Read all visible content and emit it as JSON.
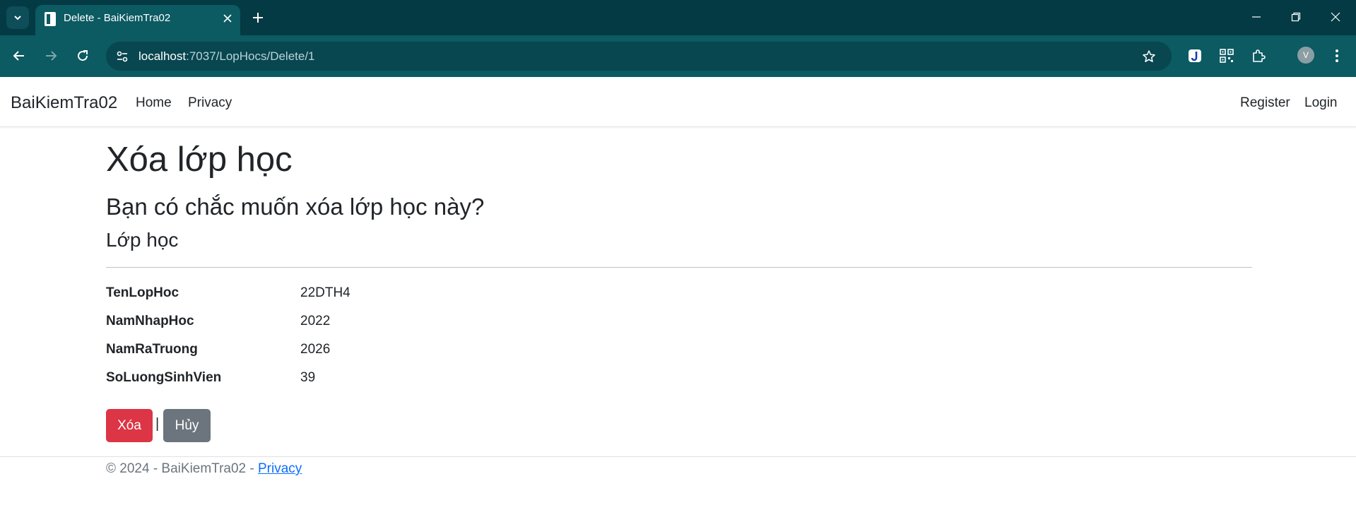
{
  "browser": {
    "tab_title": "Delete - BaiKiemTra02",
    "url_host": "localhost",
    "url_rest": ":7037/LopHocs/Delete/1",
    "profile_initial": "V"
  },
  "navbar": {
    "brand": "BaiKiemTra02",
    "links": [
      "Home",
      "Privacy"
    ],
    "register": "Register",
    "login": "Login"
  },
  "page": {
    "title": "Xóa lớp học",
    "confirm": "Bạn có chắc muốn xóa lớp học này?",
    "section": "Lớp học",
    "fields": [
      {
        "label": "TenLopHoc",
        "value": "22DTH4"
      },
      {
        "label": "NamNhapHoc",
        "value": "2022"
      },
      {
        "label": "NamRaTruong",
        "value": "2026"
      },
      {
        "label": "SoLuongSinhVien",
        "value": "39"
      }
    ],
    "delete_label": "Xóa",
    "separator": "|",
    "cancel_label": "Hủy"
  },
  "footer": {
    "text": "© 2024 - BaiKiemTra02 - ",
    "link": "Privacy"
  },
  "colors": {
    "tabstrip": "#043a44",
    "toolbar": "#0c5a62",
    "danger": "#dc3545",
    "secondary": "#6c757d",
    "link": "#0d6efd"
  }
}
